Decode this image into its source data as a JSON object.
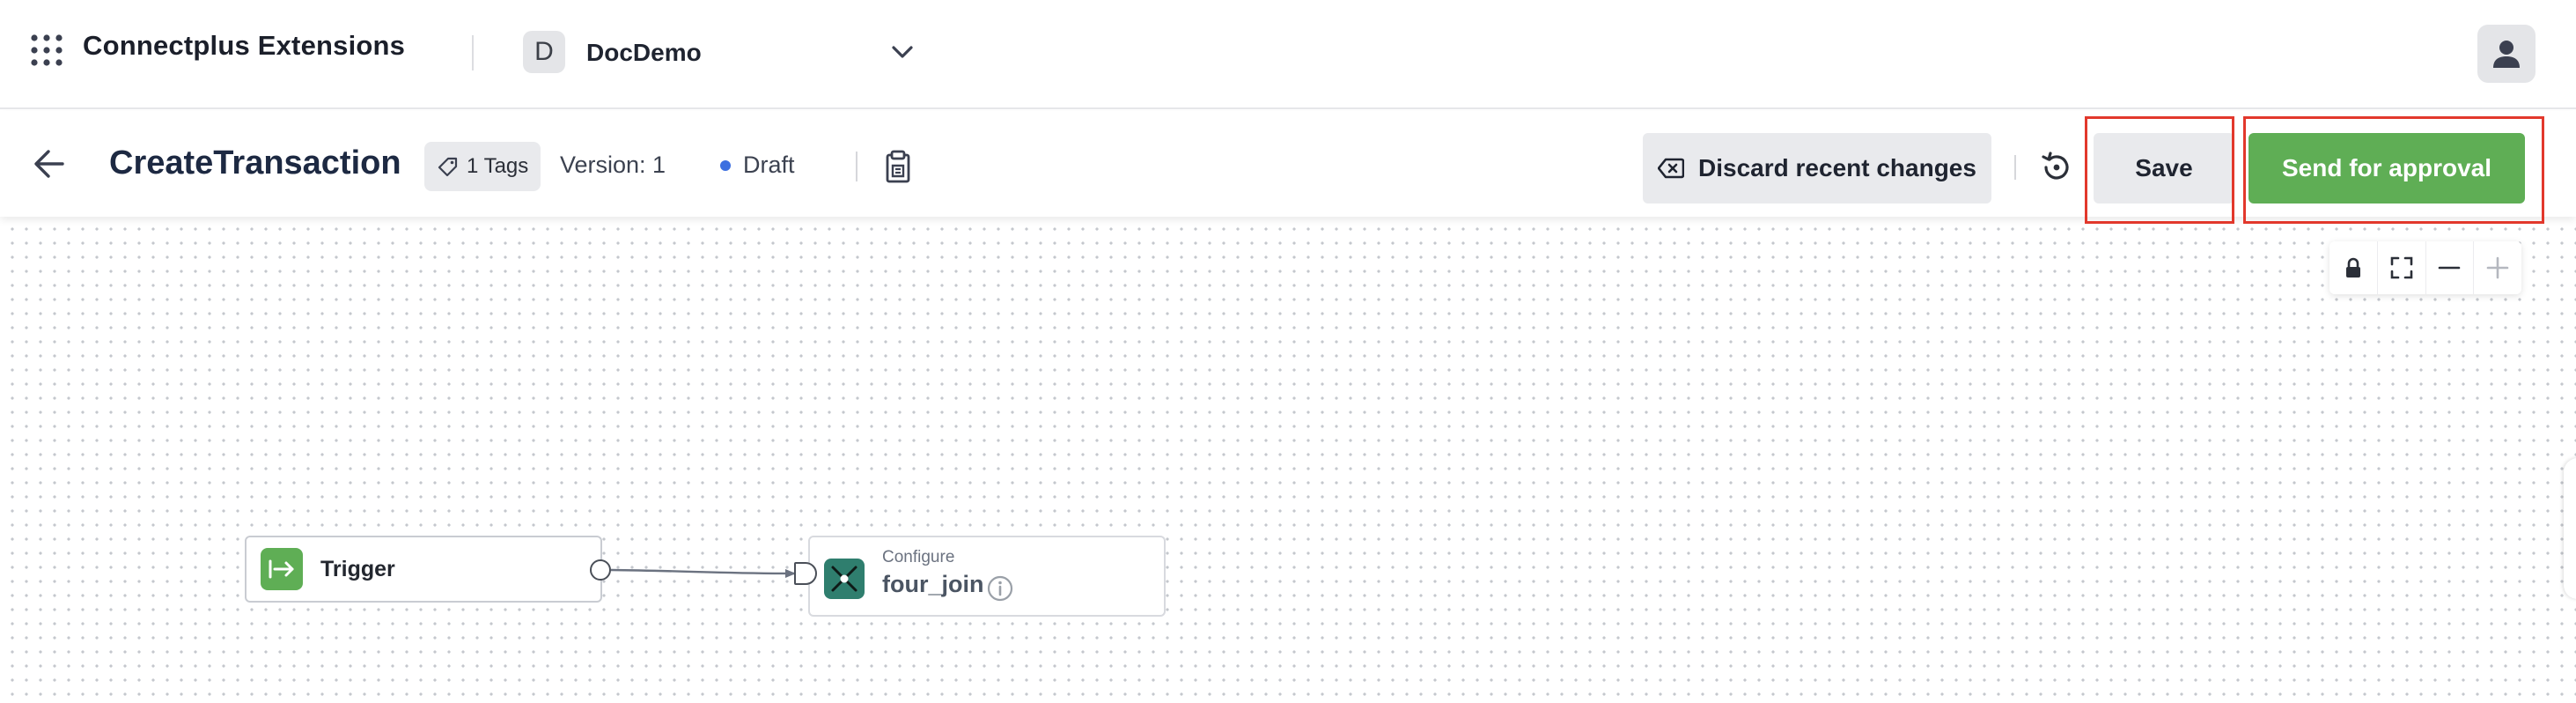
{
  "app": {
    "title": "Connectplus Extensions",
    "org_initial": "D",
    "org_name": "DocDemo"
  },
  "header": {
    "title": "CreateTransaction",
    "tags_label": "1 Tags",
    "version": "Version: 1",
    "status": "Draft",
    "discard_label": "Discard recent changes",
    "save_label": "Save",
    "approval_label": "Send for approval"
  },
  "colors": {
    "accent_green": "#5fae55",
    "status_dot": "#3c6fe0",
    "highlight": "#e2382c",
    "join_icon_bg": "#2f7e6e"
  },
  "icons": {
    "apps": "grid-dots-icon",
    "chevron": "chevron-down-icon",
    "avatar": "user-icon",
    "back": "arrow-left-icon",
    "tag": "tag-icon",
    "doc": "document-icon",
    "discard": "backspace-icon",
    "history": "history-icon",
    "lock": "lock-icon",
    "fit": "fit-view-icon",
    "zoom_out": "minus-icon",
    "zoom_in": "plus-icon",
    "trigger": "arrow-right-bar-icon",
    "join": "join-icon",
    "info": "info-icon"
  },
  "canvas": {
    "trigger_label": "Trigger",
    "config_kicker": "Configure",
    "config_name": "four_join"
  }
}
